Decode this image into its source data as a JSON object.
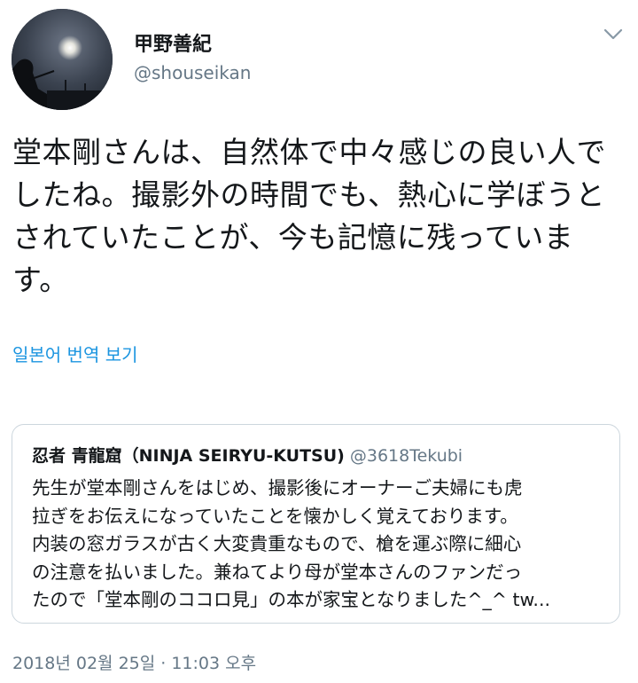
{
  "user": {
    "display_name": "甲野善紀",
    "handle": "@shouseikan"
  },
  "tweet": {
    "text": "堂本剛さんは、自然体で中々感じの良い人でしたね。撮影外の時間でも、熱心に学ぼうとされていたことが、今も記憶に残っています。",
    "translate_label": "일본어 번역 보기",
    "timestamp": "2018년 02월 25일 · 11:03 오후"
  },
  "quoted_tweet": {
    "display_name": "忍者 青龍窟（NINJA SEIRYU-KUTSU)",
    "handle": "@3618Tekubi",
    "text": "先生が堂本剛さんをはじめ、撮影後にオーナーご夫婦にも虎\n拉ぎをお伝えになっていたことを懐かしく覚えております。\n内装の窓ガラスが古く大変貴重なもので、槍を運ぶ際に細心\nの注意を払いました。兼ねてより母が堂本さんのファンだっ\nたので「堂本剛のココロ見」の本が家宝となりました^_^ tw..."
  },
  "icons": {
    "caret": "chevron-down-icon"
  },
  "colors": {
    "link": "#1b95e0",
    "secondary_text": "#657786",
    "border": "#ccd6dd"
  }
}
